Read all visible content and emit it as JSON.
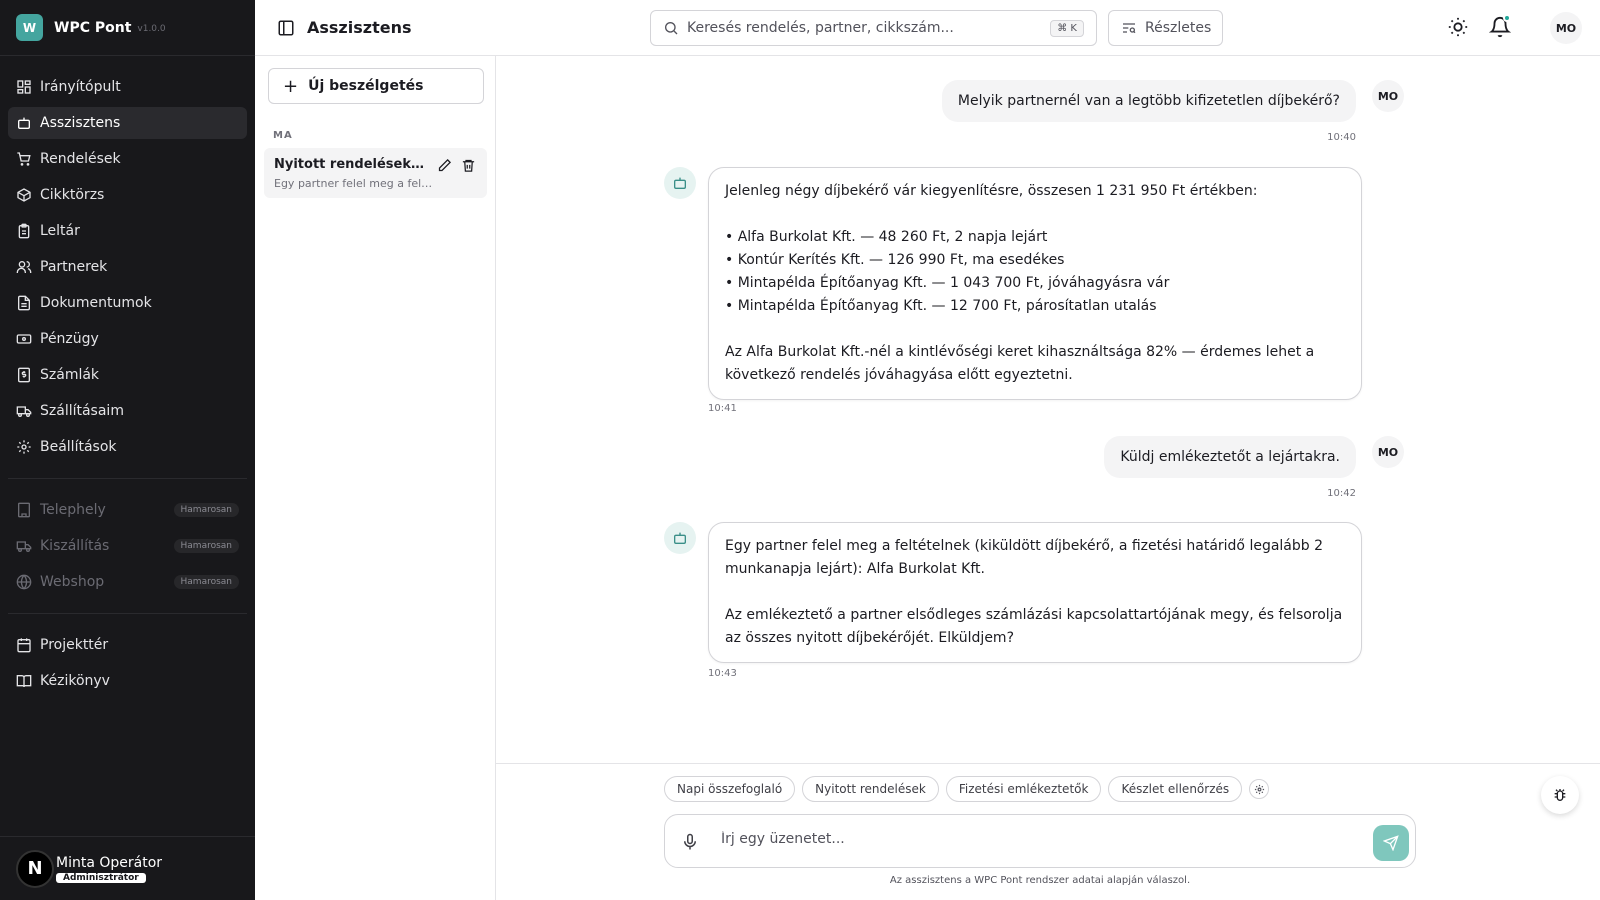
{
  "app": {
    "logo_letter": "W",
    "name": "WPC Pont",
    "version": "v1.0.0"
  },
  "sidebar": {
    "items": [
      {
        "label": "Irányítópult",
        "icon": "dashboard-icon"
      },
      {
        "label": "Asszisztens",
        "icon": "bot-icon",
        "active": true
      },
      {
        "label": "Rendelések",
        "icon": "cart-icon"
      },
      {
        "label": "Cikktörzs",
        "icon": "package-icon"
      },
      {
        "label": "Leltár",
        "icon": "clipboard-icon"
      },
      {
        "label": "Partnerek",
        "icon": "users-icon"
      },
      {
        "label": "Dokumentumok",
        "icon": "document-icon"
      },
      {
        "label": "Pénzügy",
        "icon": "banknote-icon"
      },
      {
        "label": "Számlák",
        "icon": "receipt-icon"
      },
      {
        "label": "Szállításaim",
        "icon": "truck-icon"
      },
      {
        "label": "Beállítások",
        "icon": "gear-icon"
      }
    ],
    "coming": [
      {
        "label": "Telephely",
        "badge": "Hamarosan",
        "icon": "building-icon"
      },
      {
        "label": "Kiszállítás",
        "badge": "Hamarosan",
        "icon": "truck-icon"
      },
      {
        "label": "Webshop",
        "badge": "Hamarosan",
        "icon": "globe-icon"
      }
    ],
    "extra": [
      {
        "label": "Projekttér",
        "icon": "calendar-icon"
      },
      {
        "label": "Kézikönyv",
        "icon": "book-icon"
      }
    ],
    "user": {
      "avatar": "N",
      "name": "Minta Operátor",
      "role": "Adminisztrátor"
    }
  },
  "header": {
    "title": "Asszisztens",
    "search_placeholder": "Keresés rendelés, partner, cikkszám...",
    "search_shortcut": "⌘ K",
    "detail_label": "Részletes",
    "user_initials": "MO"
  },
  "conversations": {
    "new_label": "Új beszélgetés",
    "group_label": "MA",
    "items": [
      {
        "title": "Nyitott rendelések és fizetési emlékeztetők",
        "preview": "Egy partner felel meg a feltételnek (kiküldött díjbekérő…"
      }
    ]
  },
  "chat": {
    "messages": [
      {
        "role": "user",
        "text": "Melyik partnernél van a legtöbb kifizetetlen díjbekérő?",
        "time": "10:40",
        "initials": "MO"
      },
      {
        "role": "assistant",
        "time": "10:41",
        "lines": [
          "Jelenleg négy díjbekérő vár kiegyenlítésre, összesen 1 231 950 Ft értékben:",
          "",
          "• Alfa Burkolat Kft. — 48 260 Ft, 2 napja lejárt",
          "• Kontúr Kerítés Kft. — 126 990 Ft, ma esedékes",
          "• Mintapélda Építőanyag Kft. — 1 043 700 Ft, jóváhagyásra vár",
          "• Mintapélda Építőanyag Kft. — 12 700 Ft, párosítatlan utalás",
          "",
          "Az Alfa Burkolat Kft.-nél a kintlévőségi keret kihasználtsága 82% — érdemes lehet a következő rendelés jóváhagyása előtt egyeztetni."
        ]
      },
      {
        "role": "user",
        "text": "Küldj emlékeztetőt a lejártakra.",
        "time": "10:42",
        "initials": "MO"
      },
      {
        "role": "assistant",
        "time": "10:43",
        "lines": [
          "Egy partner felel meg a feltételnek (kiküldött díjbekérő, a fizetési határidő legalább 2 munkanapja lejárt): Alfa Burkolat Kft.",
          "",
          "Az emlékeztető a partner elsődleges számlázási kapcsolattartójának megy, és felsorolja az összes nyitott díjbekérőjét. Elküldjem?"
        ]
      }
    ]
  },
  "quick_actions": [
    "Napi összefoglaló",
    "Nyitott rendelések",
    "Fizetési emlékeztetők",
    "Készlet ellenőrzés"
  ],
  "composer": {
    "placeholder": "Írj egy üzenetet...",
    "footnote": "Az asszisztens a WPC Pont rendszer adatai alapján válaszol."
  },
  "colors": {
    "accent": "#44a59f",
    "sidebar_bg": "#18181b",
    "send_bg": "#7fc7bd"
  }
}
